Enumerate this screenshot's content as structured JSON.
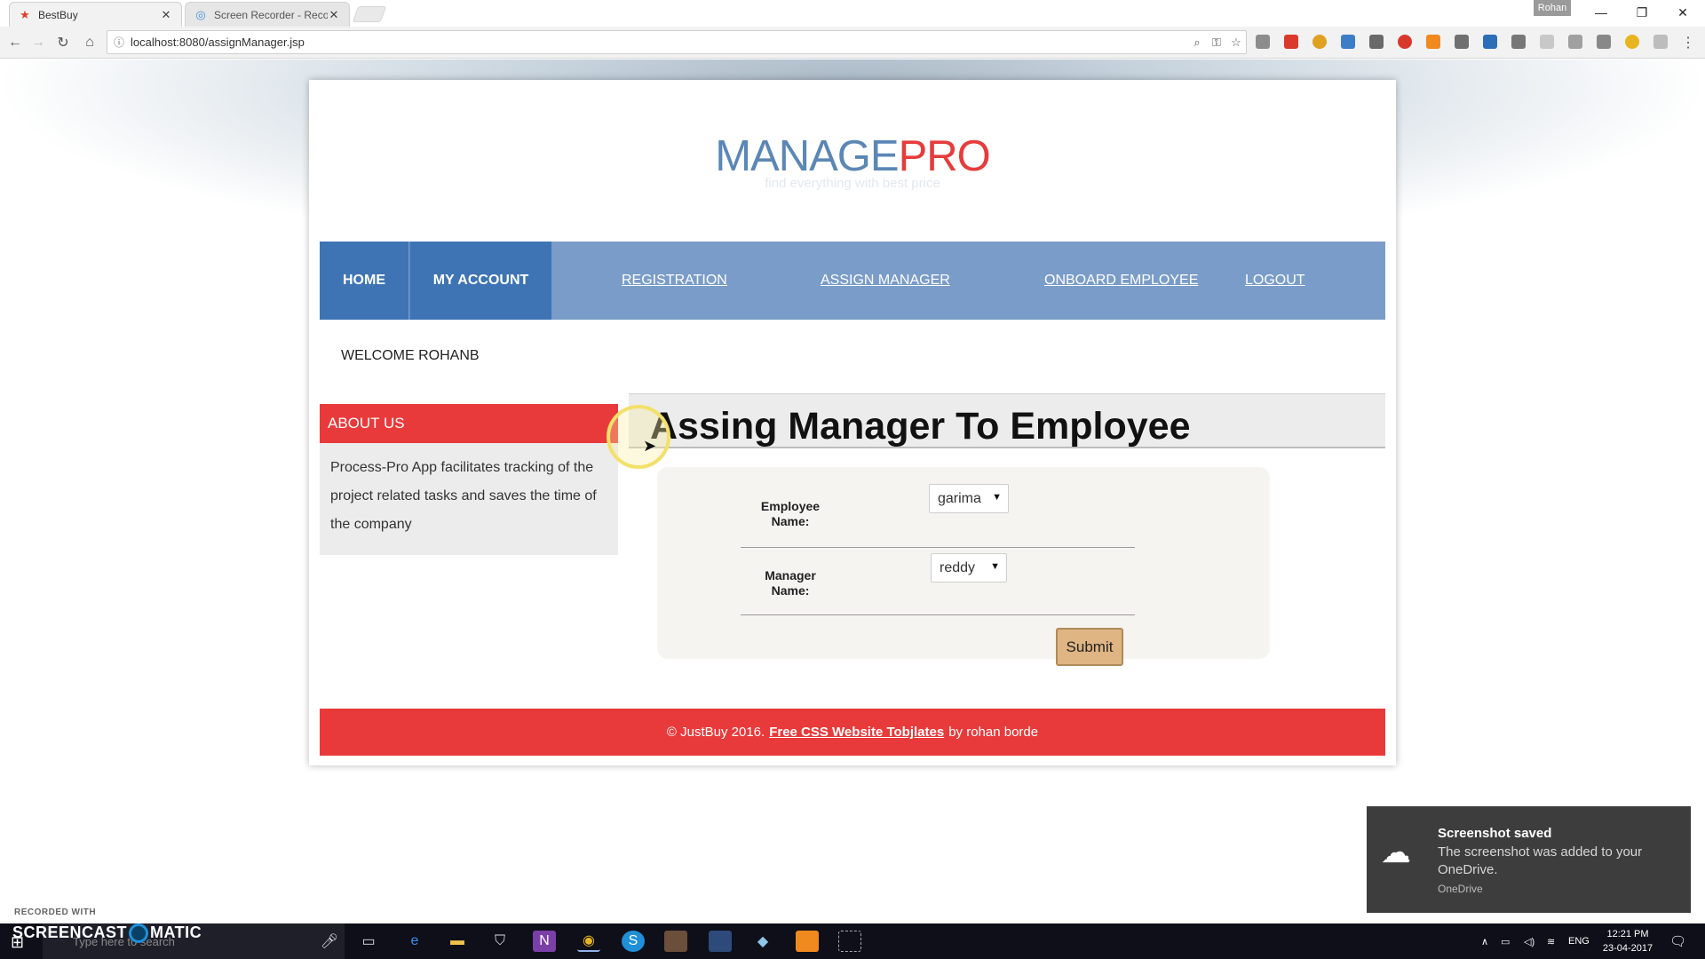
{
  "browser": {
    "tabs": [
      {
        "title": "BestBuy",
        "active": true
      },
      {
        "title": "Screen Recorder - Recor",
        "active": false
      }
    ],
    "profile": "Rohan",
    "url": "localhost:8080/assignManager.jsp"
  },
  "site": {
    "logo_part1": "MANAGE",
    "logo_part2": "PRO",
    "tagline": "find everything with best price",
    "nav": {
      "home": "HOME",
      "my_account": "MY ACCOUNT",
      "registration": "REGISTRATION",
      "assign_manager": "ASSIGN MANAGER",
      "onboard_employee": "ONBOARD EMPLOYEE",
      "logout": "LOGOUT"
    },
    "welcome": "WELCOME ROHANB",
    "about": {
      "heading": "ABOUT US",
      "text": "Process-Pro App facilitates tracking of the project related tasks and saves the time of the company"
    },
    "page_title": "Assing Manager To Employee",
    "form": {
      "employee_label_line1": "Employee",
      "employee_label_line2": "Name:",
      "employee_value": "garima",
      "manager_label_line1": "Manager",
      "manager_label_line2": "Name:",
      "manager_value": "reddy",
      "submit_label": "Submit"
    },
    "footer": {
      "prefix": "© JustBuy 2016.",
      "link": "Free CSS Website Tobjlates",
      "suffix": "by rohan borde"
    }
  },
  "notification": {
    "title": "Screenshot saved",
    "body": "The screenshot was added to your OneDrive.",
    "source": "OneDrive"
  },
  "watermark": {
    "small": "RECORDED WITH",
    "big_left": "SCREENCAST",
    "big_right": "MATIC"
  },
  "taskbar": {
    "search_placeholder": "Type here to search",
    "language": "ENG",
    "time": "12:21 PM",
    "date": "23-04-2017"
  },
  "colors": {
    "nav_bg": "#7a9cc8",
    "nav_active": "#3e74b4",
    "accent_red": "#e83a3a",
    "logo_blue": "#5b87b5",
    "submit_bg": "#deb583"
  }
}
